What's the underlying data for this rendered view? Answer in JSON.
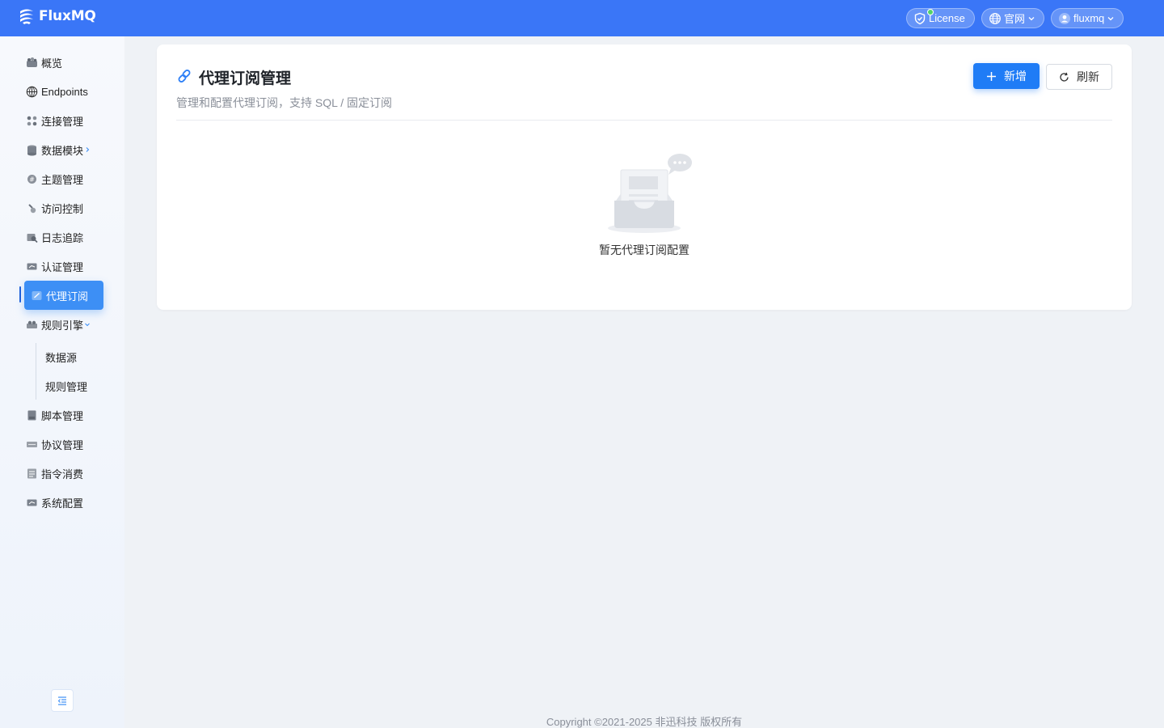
{
  "header": {
    "logo_text": "FluxMQ",
    "license_label": "License",
    "site_label": "官网",
    "user_label": "fluxmq"
  },
  "sidebar": {
    "items": [
      {
        "label": "概览",
        "icon": "dashboard-icon"
      },
      {
        "label": "Endpoints",
        "icon": "globe-icon"
      },
      {
        "label": "连接管理",
        "icon": "connection-icon"
      },
      {
        "label": "数据模块",
        "icon": "database-icon"
      },
      {
        "label": "主题管理",
        "icon": "topic-icon"
      },
      {
        "label": "访问控制",
        "icon": "access-control-icon"
      },
      {
        "label": "日志追踪",
        "icon": "log-trace-icon"
      },
      {
        "label": "认证管理",
        "icon": "auth-icon"
      },
      {
        "label": "代理订阅",
        "icon": "proxy-subscribe-icon"
      },
      {
        "label": "规则引擎",
        "icon": "rule-engine-icon"
      },
      {
        "label": "脚本管理",
        "icon": "script-icon"
      },
      {
        "label": "协议管理",
        "icon": "protocol-icon"
      },
      {
        "label": "指令消费",
        "icon": "command-icon"
      },
      {
        "label": "系统配置",
        "icon": "settings-icon"
      }
    ],
    "sub_items": [
      {
        "label": "数据源"
      },
      {
        "label": "规则管理"
      }
    ],
    "active_label": "代理订阅"
  },
  "card": {
    "title": "代理订阅管理",
    "subtitle": "管理和配置代理订阅，支持 SQL / 固定订阅",
    "add_label": "新增",
    "refresh_label": "刷新",
    "empty_text": "暂无代理订阅配置"
  },
  "footer": {
    "copyright": "Copyright ©2021-2025 非迅科技 版权所有"
  },
  "colors": {
    "header_bg": "#3a76f7",
    "primary": "#1f7cf6",
    "active_nav": "#3d8ff5",
    "license_dot": "#52d36a"
  }
}
